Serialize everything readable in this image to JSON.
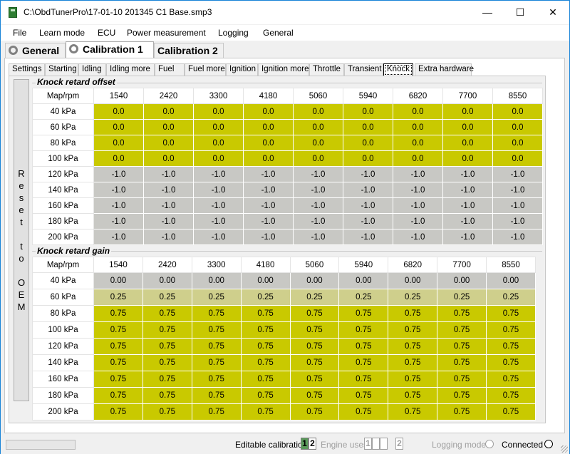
{
  "window": {
    "title": "C:\\ObdTunerPro\\17-01-10 201345 C1 Base.smp3",
    "minimize": "—",
    "maximize": "☐",
    "close": "✕",
    "icon": "document-app-icon"
  },
  "menu": [
    "File",
    "Learn mode",
    "ECU",
    "Power measurement",
    "Logging",
    "General"
  ],
  "outer_tabs": [
    {
      "label": "General",
      "icon": "gear-icon",
      "active": false
    },
    {
      "label": "Calibration 1",
      "icon": "gear-icon",
      "active": true
    },
    {
      "label": "Calibration 2",
      "icon": "",
      "active": false
    }
  ],
  "inner_tabs": [
    {
      "label": "Settings",
      "active": false
    },
    {
      "label": "Starting",
      "active": false
    },
    {
      "label": "Idling",
      "active": false
    },
    {
      "label": "Idling more",
      "active": false
    },
    {
      "label": "Fuel",
      "active": false
    },
    {
      "label": "Fuel more",
      "active": false
    },
    {
      "label": "Ignition",
      "active": false
    },
    {
      "label": "Ignition more",
      "active": false
    },
    {
      "label": "Throttle",
      "active": false
    },
    {
      "label": "Transient",
      "active": false
    },
    {
      "label": "Knock",
      "active": true
    },
    {
      "label": "Extra hardware",
      "active": false
    }
  ],
  "reset_button": {
    "letters": [
      "R",
      "e",
      "s",
      "e",
      "t",
      "",
      "t",
      "o",
      "",
      "O",
      "E",
      "M"
    ]
  },
  "colors": {
    "yellow": "#c9c900",
    "grey": "#c8c8c4",
    "light": "#cfcf8c"
  },
  "tables": [
    {
      "title": "Knock retard offset",
      "corner": "Map/rpm",
      "columns": [
        "1540",
        "2420",
        "3300",
        "4180",
        "5060",
        "5940",
        "6820",
        "7700",
        "8550"
      ],
      "rows": [
        {
          "label": "40 kPa",
          "color": "yellow",
          "values": [
            "0.0",
            "0.0",
            "0.0",
            "0.0",
            "0.0",
            "0.0",
            "0.0",
            "0.0",
            "0.0"
          ]
        },
        {
          "label": "60 kPa",
          "color": "yellow",
          "values": [
            "0.0",
            "0.0",
            "0.0",
            "0.0",
            "0.0",
            "0.0",
            "0.0",
            "0.0",
            "0.0"
          ]
        },
        {
          "label": "80 kPa",
          "color": "yellow",
          "values": [
            "0.0",
            "0.0",
            "0.0",
            "0.0",
            "0.0",
            "0.0",
            "0.0",
            "0.0",
            "0.0"
          ]
        },
        {
          "label": "100 kPa",
          "color": "yellow",
          "values": [
            "0.0",
            "0.0",
            "0.0",
            "0.0",
            "0.0",
            "0.0",
            "0.0",
            "0.0",
            "0.0"
          ]
        },
        {
          "label": "120 kPa",
          "color": "grey",
          "values": [
            "-1.0",
            "-1.0",
            "-1.0",
            "-1.0",
            "-1.0",
            "-1.0",
            "-1.0",
            "-1.0",
            "-1.0"
          ]
        },
        {
          "label": "140 kPa",
          "color": "grey",
          "values": [
            "-1.0",
            "-1.0",
            "-1.0",
            "-1.0",
            "-1.0",
            "-1.0",
            "-1.0",
            "-1.0",
            "-1.0"
          ]
        },
        {
          "label": "160 kPa",
          "color": "grey",
          "values": [
            "-1.0",
            "-1.0",
            "-1.0",
            "-1.0",
            "-1.0",
            "-1.0",
            "-1.0",
            "-1.0",
            "-1.0"
          ]
        },
        {
          "label": "180 kPa",
          "color": "grey",
          "values": [
            "-1.0",
            "-1.0",
            "-1.0",
            "-1.0",
            "-1.0",
            "-1.0",
            "-1.0",
            "-1.0",
            "-1.0"
          ]
        },
        {
          "label": "200 kPa",
          "color": "grey",
          "values": [
            "-1.0",
            "-1.0",
            "-1.0",
            "-1.0",
            "-1.0",
            "-1.0",
            "-1.0",
            "-1.0",
            "-1.0"
          ]
        }
      ]
    },
    {
      "title": "Knock retard gain",
      "corner": "Map/rpm",
      "columns": [
        "1540",
        "2420",
        "3300",
        "4180",
        "5060",
        "5940",
        "6820",
        "7700",
        "8550"
      ],
      "rows": [
        {
          "label": "40 kPa",
          "color": "grey",
          "values": [
            "0.00",
            "0.00",
            "0.00",
            "0.00",
            "0.00",
            "0.00",
            "0.00",
            "0.00",
            "0.00"
          ]
        },
        {
          "label": "60 kPa",
          "color": "light",
          "values": [
            "0.25",
            "0.25",
            "0.25",
            "0.25",
            "0.25",
            "0.25",
            "0.25",
            "0.25",
            "0.25"
          ]
        },
        {
          "label": "80 kPa",
          "color": "yellow",
          "values": [
            "0.75",
            "0.75",
            "0.75",
            "0.75",
            "0.75",
            "0.75",
            "0.75",
            "0.75",
            "0.75"
          ]
        },
        {
          "label": "100 kPa",
          "color": "yellow",
          "values": [
            "0.75",
            "0.75",
            "0.75",
            "0.75",
            "0.75",
            "0.75",
            "0.75",
            "0.75",
            "0.75"
          ]
        },
        {
          "label": "120 kPa",
          "color": "yellow",
          "values": [
            "0.75",
            "0.75",
            "0.75",
            "0.75",
            "0.75",
            "0.75",
            "0.75",
            "0.75",
            "0.75"
          ]
        },
        {
          "label": "140 kPa",
          "color": "yellow",
          "values": [
            "0.75",
            "0.75",
            "0.75",
            "0.75",
            "0.75",
            "0.75",
            "0.75",
            "0.75",
            "0.75"
          ]
        },
        {
          "label": "160 kPa",
          "color": "yellow",
          "values": [
            "0.75",
            "0.75",
            "0.75",
            "0.75",
            "0.75",
            "0.75",
            "0.75",
            "0.75",
            "0.75"
          ]
        },
        {
          "label": "180 kPa",
          "color": "yellow",
          "values": [
            "0.75",
            "0.75",
            "0.75",
            "0.75",
            "0.75",
            "0.75",
            "0.75",
            "0.75",
            "0.75"
          ]
        },
        {
          "label": "200 kPa",
          "color": "yellow",
          "values": [
            "0.75",
            "0.75",
            "0.75",
            "0.75",
            "0.75",
            "0.75",
            "0.75",
            "0.75",
            "0.75"
          ]
        }
      ]
    }
  ],
  "status": {
    "editable_label": "Editable calibration",
    "editable_values": [
      "1",
      "2"
    ],
    "engine_label": "Engine uses",
    "engine_values": [
      "1",
      "",
      "",
      "2"
    ],
    "logging_label": "Logging mode",
    "connected_label": "Connected"
  }
}
